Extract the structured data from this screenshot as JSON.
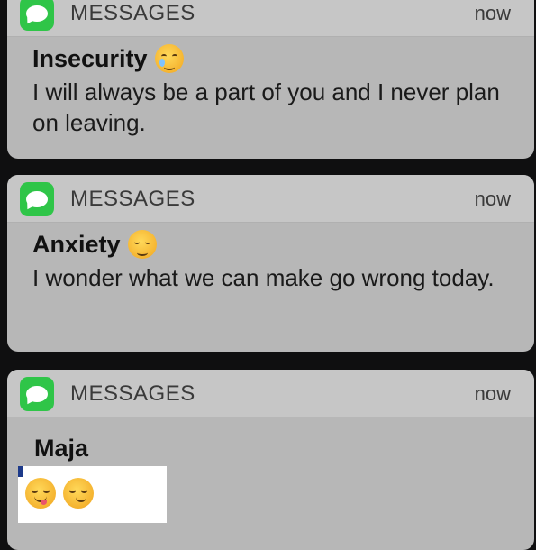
{
  "notifications": [
    {
      "app_name": "MESSAGES",
      "time": "now",
      "sender": "Insecurity",
      "sender_emoji": "crying-face-icon",
      "message": "I will always be a part of you and I never plan on leaving."
    },
    {
      "app_name": "MESSAGES",
      "time": "now",
      "sender": "Anxiety",
      "sender_emoji": "disappointed-face-icon",
      "message": "I wonder what we can make go wrong today."
    },
    {
      "app_name": "MESSAGES",
      "time": "now",
      "sender": "Maja",
      "sender_emoji": "",
      "message": ""
    }
  ],
  "overlay": {
    "emojis": [
      "face-savoring-food-icon",
      "smirking-face-icon"
    ]
  },
  "colors": {
    "messages_green": "#2fc548",
    "card_header": "#c6c6c6",
    "card_body": "#b7b7b7",
    "background": "#0f0f10"
  }
}
